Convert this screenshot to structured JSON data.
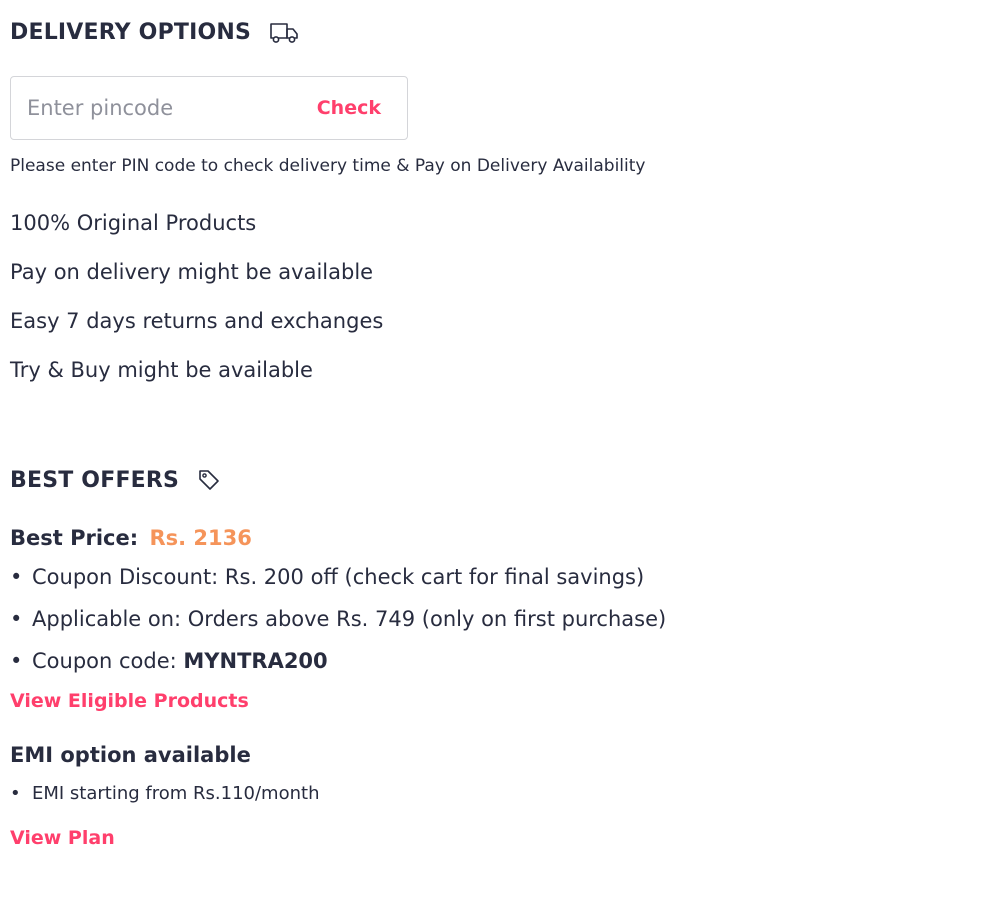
{
  "delivery": {
    "title": "DELIVERY OPTIONS",
    "icon": "truck-icon",
    "pincode_placeholder": "Enter pincode",
    "check_label": "Check",
    "help_text": "Please enter PIN code to check delivery time & Pay on Delivery Availability",
    "features": [
      "100% Original Products",
      "Pay on delivery might be available",
      "Easy 7 days returns and exchanges",
      "Try & Buy might be available"
    ]
  },
  "offers": {
    "title": "BEST OFFERS",
    "icon": "tag-icon",
    "best_price_label": "Best Price:",
    "best_price_value": "Rs. 2136",
    "bullets": [
      "Coupon Discount: Rs. 200 off (check cart for final savings)",
      "Applicable on: Orders above Rs. 749 (only on first purchase)"
    ],
    "coupon_label": "Coupon code:",
    "coupon_code": "MYNTRA200",
    "view_eligible_label": "View Eligible Products",
    "emi_title": "EMI option available",
    "emi_bullet": "EMI starting from Rs.110/month",
    "view_plan_label": "View Plan"
  },
  "colors": {
    "accent": "#ff3f6c",
    "price": "#f5945a",
    "text": "#282c3f",
    "border": "#d4d5d9"
  }
}
